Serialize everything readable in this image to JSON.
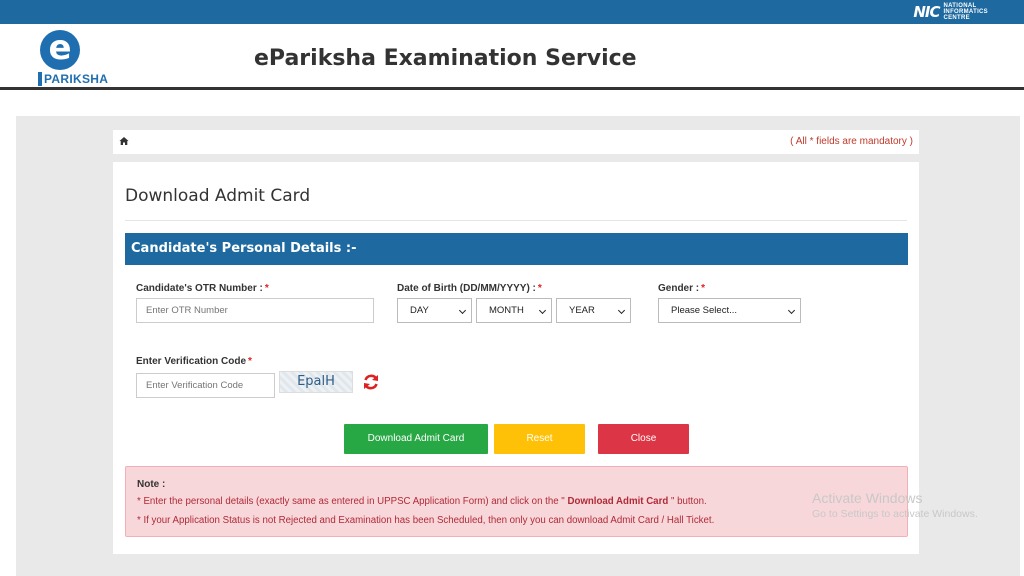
{
  "topbar": {
    "nic_mark": "NIC",
    "nic_text_1": "NATIONAL",
    "nic_text_2": "INFORMATICS",
    "nic_text_3": "CENTRE"
  },
  "header": {
    "logo_letter": "e",
    "logo_text": "PARIKSHA",
    "title": "ePariksha Examination Service"
  },
  "breadcrumb": {
    "home_icon": "home-icon",
    "mandatory_note": "( All * fields are mandatory )"
  },
  "card": {
    "title": "Download Admit Card",
    "section_title": "Candidate's Personal Details :-"
  },
  "form": {
    "otr": {
      "label": "Candidate's OTR Number :",
      "required": "*",
      "placeholder": "Enter OTR Number"
    },
    "dob": {
      "label": "Date of Birth (DD/MM/YYYY) :",
      "required": "*",
      "day": "DAY",
      "month": "MONTH",
      "year": "YEAR"
    },
    "gender": {
      "label": "Gender :",
      "required": "*",
      "value": "Please Select..."
    },
    "verification": {
      "label": "Enter Verification Code",
      "required": "*",
      "placeholder": "Enter Verification Code",
      "captcha_text": "EpalH"
    }
  },
  "buttons": {
    "download": "Download Admit Card",
    "reset": "Reset",
    "close": "Close"
  },
  "colors": {
    "brand_blue": "#1e6aa0",
    "green": "#28a745",
    "yellow": "#ffc107",
    "red": "#dc3545",
    "note_bg": "#f8d7da"
  },
  "note": {
    "heading": "Note :",
    "line1_a": "* Enter the personal details (exactly same as entered in UPPSC Application Form) and click on the \"",
    "line1_bold": " Download Admit Card ",
    "line1_b": "\" button.",
    "line2": "* If your Application Status is not Rejected and Examination has been Scheduled, then only you can download Admit Card / Hall Ticket."
  },
  "watermark": {
    "line1": "Activate Windows",
    "line2": "Go to Settings to activate Windows."
  }
}
